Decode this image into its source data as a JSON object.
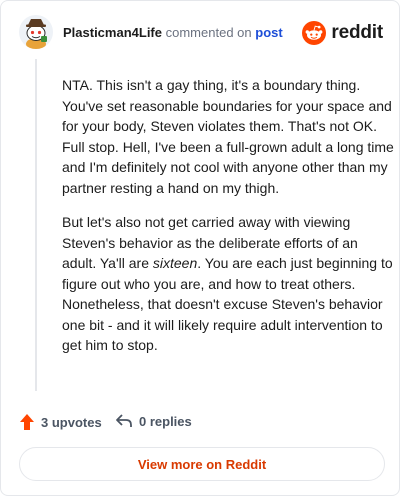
{
  "header": {
    "username": "Plasticman4Life",
    "commented_on": "commented on",
    "post_link": "post",
    "brand": "reddit",
    "avatar_icon": "snoo-avatar-icon",
    "brand_icon": "reddit-logo-icon"
  },
  "comment": {
    "paragraphs": [
      "NTA. This isn't a gay thing, it's a boundary thing. You've set reasonable boundaries for your space and for your body, Steven violates them. That's not OK. Full stop. Hell, I've been a full-grown adult a long time and I'm definitely not cool with anyone other than my partner resting a hand on my thigh."
    ],
    "p2_before": "But let's also not get carried away with viewing Steven's behavior as the deliberate efforts of an adult. Ya'll are ",
    "p2_emphasis": "sixteen",
    "p2_after": ". You are each just beginning to figure out who you are, and how to treat others. Nonetheless, that doesn't excuse Steven's behavior one bit - and it will likely require adult intervention to get him to stop."
  },
  "footer": {
    "upvotes": "3 upvotes",
    "replies": "0 replies",
    "upvote_icon": "upvote-arrow-icon",
    "reply_icon": "reply-arrow-icon"
  },
  "view_more": "View more on Reddit",
  "colors": {
    "reddit_orange": "#ff4500",
    "link_blue": "#1d4ed8",
    "cta_text": "#d93a00"
  }
}
